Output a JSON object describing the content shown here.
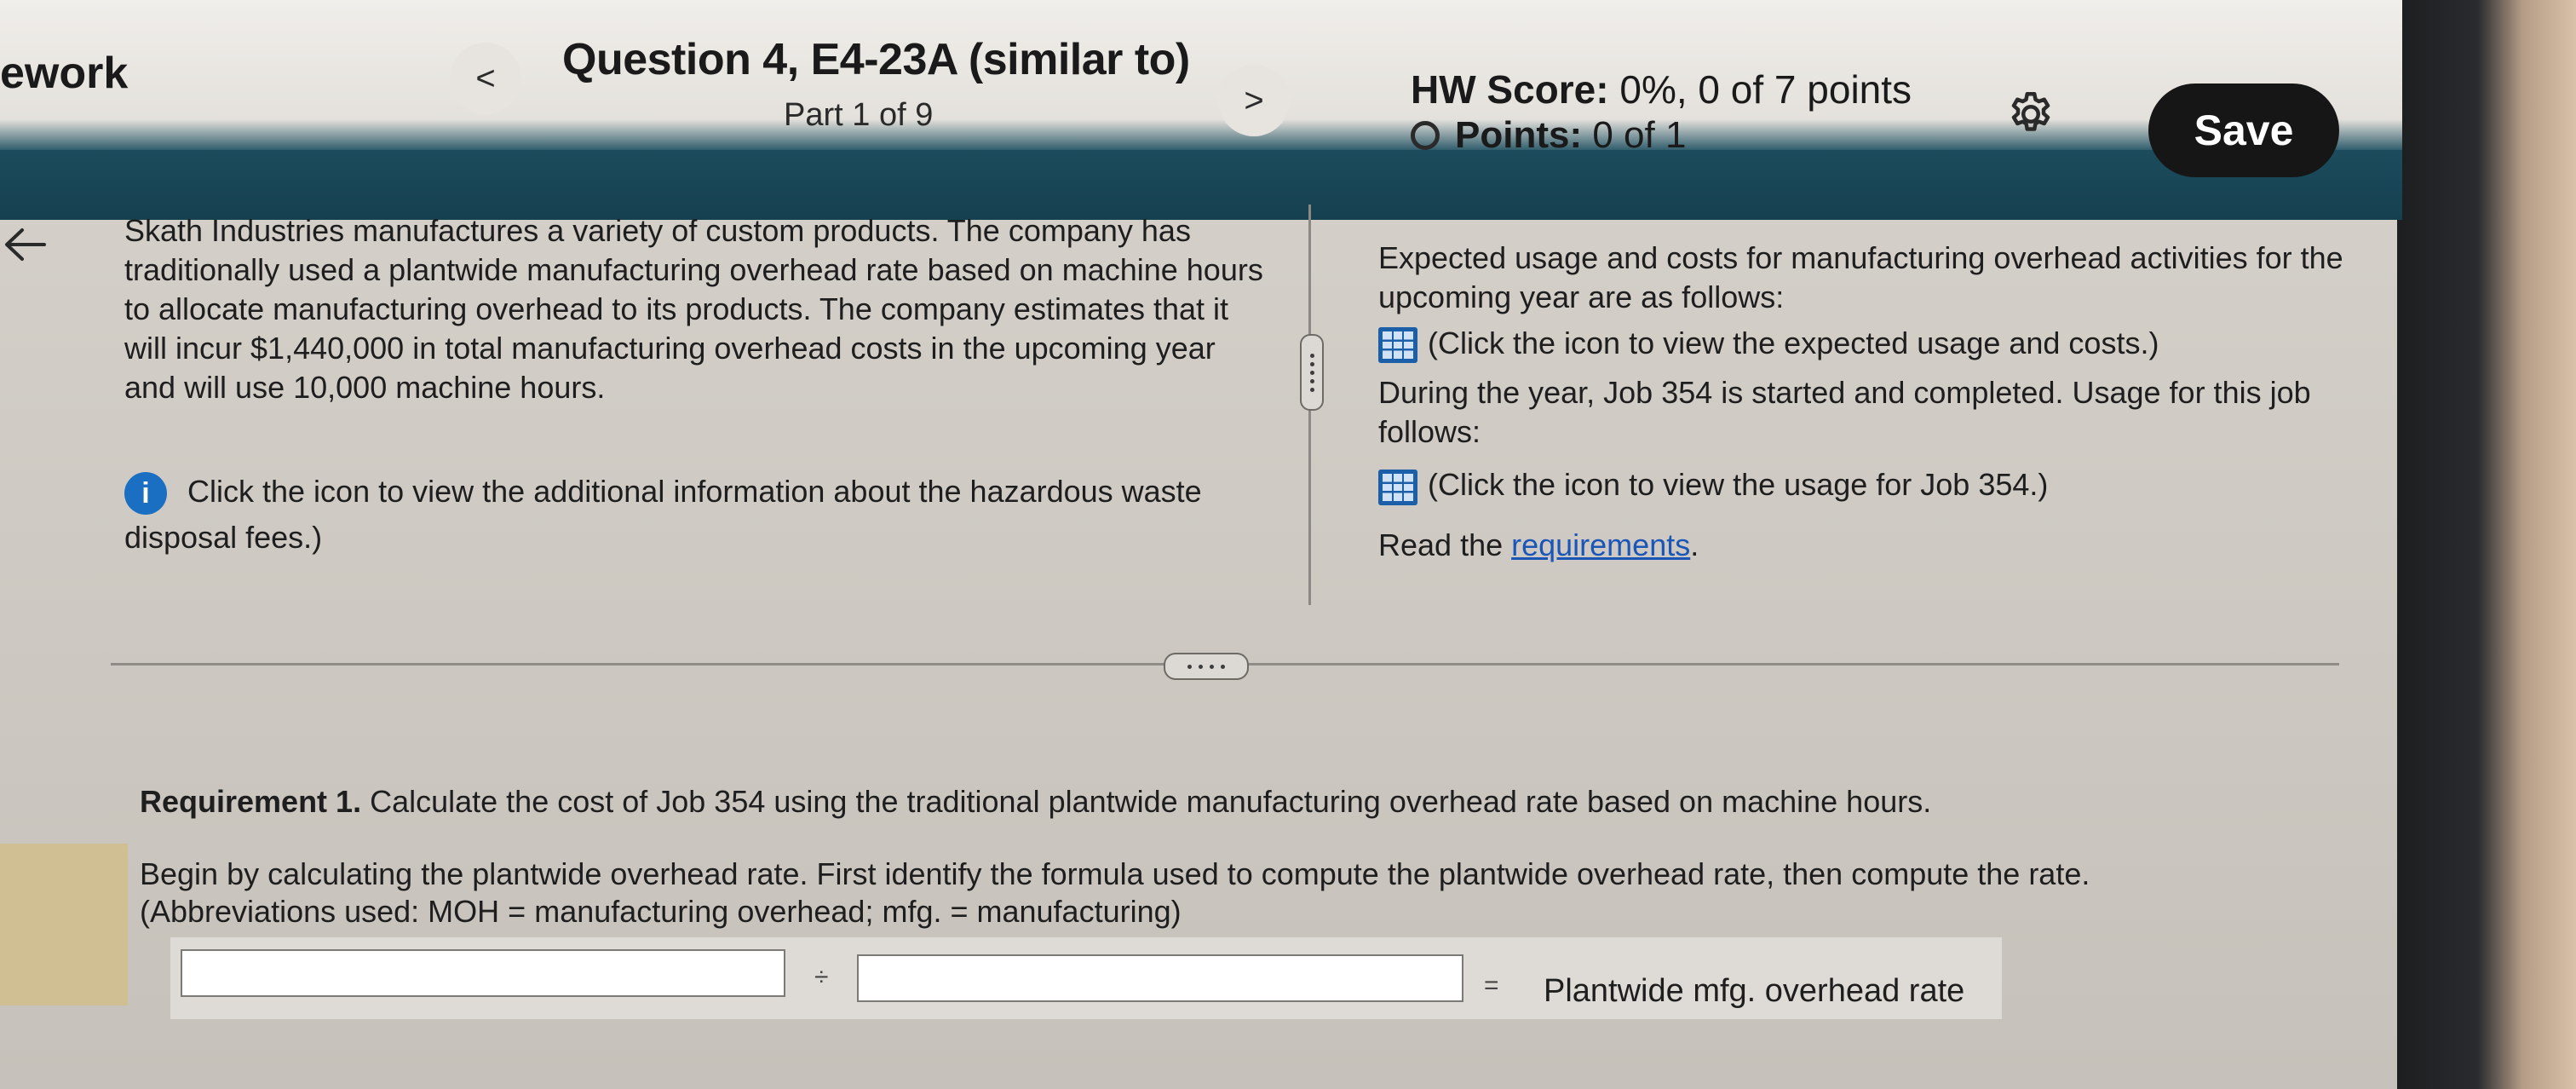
{
  "header": {
    "app_name": "ework",
    "question_title": "Question 4, E4-23A (similar to)",
    "question_part": "Part 1 of 9",
    "hw_score_label": "HW Score:",
    "hw_score_value": "0%, 0 of 7 points",
    "points_label": "Points:",
    "points_value": "0 of 1",
    "save_label": "Save",
    "prev_glyph": "<",
    "next_glyph": ">"
  },
  "left_panel": {
    "paragraph": "Skath Industries manufactures a variety of custom products. The company has traditionally used a plantwide manufacturing overhead rate based on machine hours to allocate manufacturing overhead to its products. The company estimates that it will incur $1,440,000 in total manufacturing overhead costs in the upcoming year and will use 10,000 machine hours.",
    "info_text": "Click the icon to view the additional information about the hazardous waste disposal fees.)",
    "info_glyph": "i"
  },
  "right_panel": {
    "intro": "Expected usage and costs for manufacturing overhead activities for the upcoming year are as follows:",
    "expected_link_text": "(Click the icon to view the expected usage and costs.)",
    "job_text": "During the year, Job 354 is started and completed. Usage for this job follows:",
    "job_link_text": "(Click the icon to view the usage for Job 354.)",
    "read_prefix": "Read the ",
    "requirements_link": "requirements",
    "read_suffix": "."
  },
  "question": {
    "requirement_label": "Requirement 1.",
    "requirement_text": " Calculate the cost of Job 354 using the traditional plantwide manufacturing overhead rate based on machine hours.",
    "instruction_line1": "Begin by calculating the plantwide overhead rate. First identify the formula used to compute the plantwide overhead rate, then compute the rate.",
    "instruction_line2": "(Abbreviations used: MOH = manufacturing overhead; mfg. = manufacturing)"
  },
  "formula": {
    "input1_value": "",
    "divide_op": "÷",
    "input2_value": "",
    "equals_op": "=",
    "result_label": "Plantwide mfg. overhead rate"
  },
  "icons": {
    "back": "arrow-left-icon",
    "settings": "gear-icon",
    "info": "info-icon",
    "table": "table-icon",
    "status": "circle-outline-icon"
  },
  "colors": {
    "header_band": "#184657",
    "save_button": "#161616",
    "info_icon": "#1b6fc2",
    "link": "#1a56b8"
  }
}
